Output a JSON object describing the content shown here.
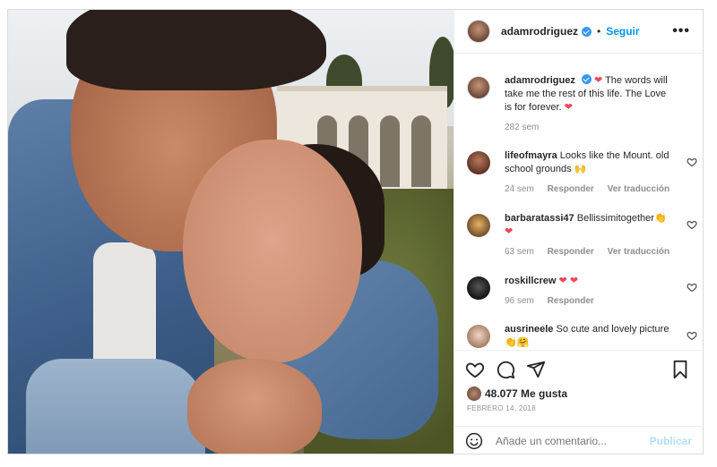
{
  "header": {
    "username": "adamrodriguez",
    "separator": "•",
    "follow_label": "Seguir",
    "more_label": "•••",
    "avatar_icon": "profile-avatar"
  },
  "caption": {
    "username": "adamrodriguez",
    "text": "The words will take me the rest of this life. The Love is for forever.",
    "time": "282 sem"
  },
  "comments": [
    {
      "username": "lifeofmayra",
      "text": "Looks like the Mount. old school grounds",
      "emoji": "🙌",
      "time": "24 sem",
      "reply": "Responder",
      "translate": "Ver traducción",
      "avatar_color": "#8a4e3a"
    },
    {
      "username": "barbaratassi47",
      "text": "Bellissimitogether",
      "emoji": "👏",
      "emoji2": "❤",
      "time": "63 sem",
      "reply": "Responder",
      "translate": "Ver traducción",
      "avatar_color": "#c58b3a"
    },
    {
      "username": "roskillcrew",
      "text": "",
      "emoji": "❤ ❤",
      "time": "96 sem",
      "reply": "Responder",
      "avatar_color": "#2b2b2b"
    },
    {
      "username": "ausrineele",
      "text": "So cute and lovely picture",
      "emoji": "👏🤗",
      "avatar_color": "#d8b8a0"
    }
  ],
  "actions": {
    "likes": "48.077 Me gusta",
    "date": "FEBRERO 14, 2018"
  },
  "add_comment": {
    "placeholder": "Añade un comentario...",
    "post_label": "Publicar"
  },
  "colors": {
    "accent": "#0095f6",
    "heart": "#ed4956",
    "muted": "#8e8e8e",
    "post_disabled": "#b2dffc"
  }
}
